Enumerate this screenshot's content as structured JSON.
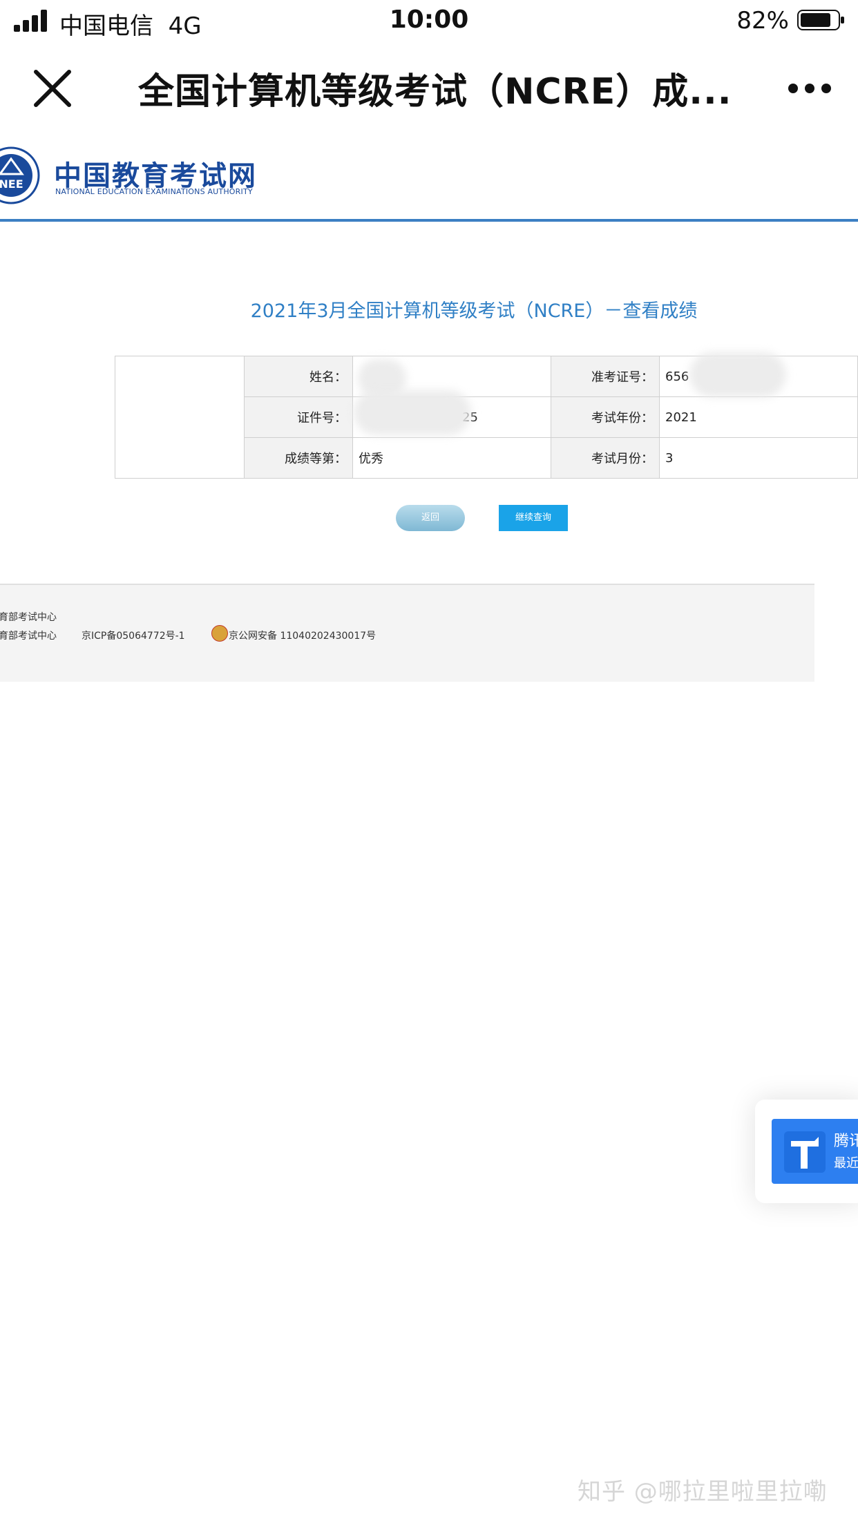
{
  "status_bar": {
    "carrier": "中国电信",
    "network": "4G",
    "time": "10:00",
    "battery_percent": "82%",
    "battery_level": 0.82
  },
  "header": {
    "title": "全国计算机等级考试（NCRE）成..."
  },
  "site": {
    "name_cn": "中国教育考试网",
    "name_en": "NATIONAL EDUCATION EXAMINATIONS AUTHORITY",
    "emblem_text": "NEE"
  },
  "page_heading": "2021年3月全国计算机等级考试（NCRE）－查看成绩",
  "result_table": {
    "rows": [
      {
        "label1": "姓名：",
        "value1": "",
        "label2": "准考证号：",
        "value2": "656"
      },
      {
        "label1": "证件号：",
        "value1": "25",
        "label2": "考试年份：",
        "value2": "2021"
      },
      {
        "label1": "成绩等第：",
        "value1": "优秀",
        "label2": "考试月份：",
        "value2": "3"
      }
    ]
  },
  "buttons": {
    "back": "返回",
    "continue": "继续查询"
  },
  "footer": {
    "line1": "育部考试中心",
    "line2": "育部考试中心",
    "icp": "京ICP备05064772号-1",
    "police": "京公网安备 11040202430017号"
  },
  "floating_widget": {
    "text1": "腾讯",
    "text2": "最近"
  },
  "watermark": "知乎 @哪拉里啦里拉嘞"
}
